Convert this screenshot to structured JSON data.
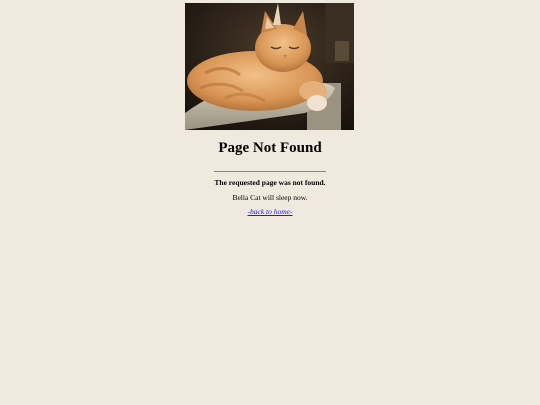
{
  "content": {
    "image_alt": "orange cat sleeping on a cat tree",
    "heading": "Page Not Found",
    "error_message": "The requested page was not found.",
    "cat_message": "Bella Cat will sleep now.",
    "back_link": "-back to home-"
  },
  "colors": {
    "background": "#f0e9dd",
    "link": "#1a1aee",
    "rule": "#8a8478"
  }
}
